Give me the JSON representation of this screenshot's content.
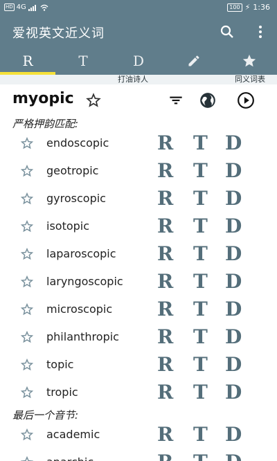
{
  "status_bar": {
    "left_badge_hd": "HD",
    "left_signal": "4G",
    "battery": "100",
    "time": "1:36"
  },
  "app_bar": {
    "title": "爱视英文近义词",
    "search_icon": "search-icon",
    "more_icon": "more-vert-icon"
  },
  "tabs": [
    {
      "label": "R",
      "active": true
    },
    {
      "label": "T",
      "active": false
    },
    {
      "label": "D",
      "active": false
    },
    {
      "label": "pencil-icon",
      "active": false
    },
    {
      "label": "star-icon",
      "active": false
    }
  ],
  "subbar": {
    "left": "打油诗人",
    "right": "同义词表"
  },
  "header": {
    "word": "myopic"
  },
  "sections": {
    "strict": "严格押韵匹配:",
    "last_syllable": "最后一个音节:"
  },
  "results": [
    "endoscopic",
    "geotropic",
    "gyroscopic",
    "isotopic",
    "laparoscopic",
    "laryngoscopic",
    "microscopic",
    "philanthropic",
    "topic",
    "tropic"
  ],
  "results2": [
    "academic",
    "anarchic"
  ],
  "row_letters": {
    "r": "R",
    "t": "T",
    "d": "D"
  },
  "colors": {
    "primary": "#607d8b",
    "accent": "#f5e13a",
    "rtd": "#546e7a"
  }
}
